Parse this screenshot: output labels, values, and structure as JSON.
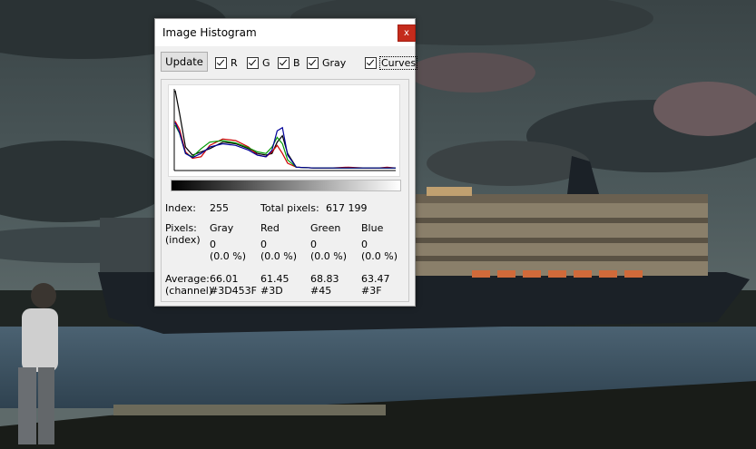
{
  "window": {
    "title": "Image Histogram",
    "close_glyph": "x"
  },
  "toolbar": {
    "update_label": "Update",
    "channels": [
      {
        "label": "R",
        "checked": true
      },
      {
        "label": "G",
        "checked": true
      },
      {
        "label": "B",
        "checked": true
      },
      {
        "label": "Gray",
        "checked": true
      },
      {
        "label": "Curves",
        "checked": true
      }
    ]
  },
  "info": {
    "index_label": "Index:",
    "index_value": "255",
    "total_label": "Total pixels:",
    "total_value": "617 199",
    "pixels_label_1": "Pixels:",
    "pixels_label_2": "(index)",
    "average_label_1": "Average:",
    "average_label_2": "(channel)",
    "columns": [
      {
        "header": "Gray",
        "count": "0",
        "percent": "(0.0 %)",
        "average": "66.01",
        "hex": "#3D453F"
      },
      {
        "header": "Red",
        "count": "0",
        "percent": "(0.0 %)",
        "average": "61.45",
        "hex": "#3D"
      },
      {
        "header": "Green",
        "count": "0",
        "percent": "(0.0 %)",
        "average": "68.83",
        "hex": "#45"
      },
      {
        "header": "Blue",
        "count": "0",
        "percent": "(0.0 %)",
        "average": "63.47",
        "hex": "#3F"
      }
    ]
  },
  "chart_data": {
    "type": "line",
    "x": [
      0,
      5,
      12,
      20,
      30,
      40,
      55,
      70,
      85,
      95,
      105,
      112,
      118,
      124,
      130,
      140,
      160,
      180,
      200,
      220,
      235,
      245,
      255
    ],
    "ylim": [
      0,
      100
    ],
    "series": [
      {
        "color": "#000000",
        "values": [
          98,
          70,
          28,
          18,
          22,
          26,
          34,
          32,
          26,
          20,
          18,
          20,
          34,
          42,
          20,
          3,
          2,
          2,
          2,
          2,
          2,
          2,
          2
        ]
      },
      {
        "color": "#cc0000",
        "values": [
          60,
          50,
          22,
          14,
          16,
          30,
          38,
          36,
          28,
          18,
          16,
          22,
          30,
          20,
          8,
          3,
          2,
          2,
          3,
          2,
          2,
          3,
          2
        ]
      },
      {
        "color": "#009900",
        "values": [
          55,
          45,
          20,
          16,
          26,
          34,
          36,
          33,
          27,
          22,
          20,
          28,
          40,
          32,
          12,
          3,
          2,
          2,
          2,
          2,
          2,
          2,
          2
        ]
      },
      {
        "color": "#000099",
        "values": [
          58,
          46,
          20,
          15,
          20,
          28,
          32,
          30,
          24,
          18,
          16,
          24,
          48,
          52,
          18,
          3,
          2,
          2,
          2,
          2,
          2,
          2,
          2
        ]
      }
    ]
  }
}
